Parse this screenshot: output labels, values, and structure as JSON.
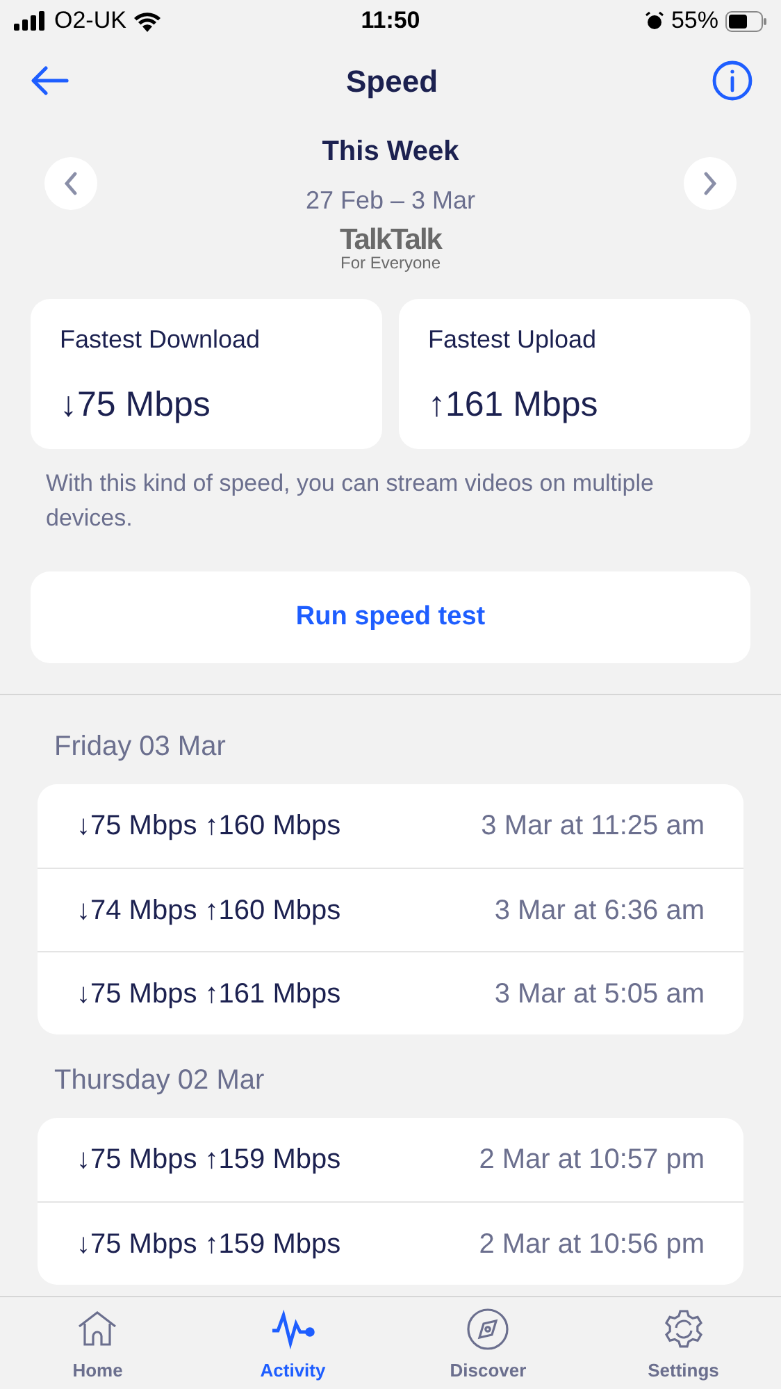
{
  "status_bar": {
    "carrier": "O2-UK",
    "time": "11:50",
    "battery": "55%"
  },
  "nav": {
    "title": "Speed"
  },
  "period": {
    "title": "This Week",
    "range": "27 Feb – 3 Mar",
    "brand": "TalkTalk",
    "tagline": "For Everyone"
  },
  "stats": [
    {
      "label": "Fastest Download",
      "value": "↓75 Mbps"
    },
    {
      "label": "Fastest Upload",
      "value": "↑161 Mbps"
    }
  ],
  "note": "With this kind of speed, you can stream videos on multiple devices.",
  "run_button": "Run speed test",
  "days": [
    {
      "title": "Friday 03 Mar",
      "tests": [
        {
          "speed": "↓75 Mbps ↑160 Mbps",
          "time": "3 Mar at 11:25 am"
        },
        {
          "speed": "↓74 Mbps ↑160 Mbps",
          "time": "3 Mar at 6:36 am"
        },
        {
          "speed": "↓75 Mbps ↑161 Mbps",
          "time": "3 Mar at 5:05 am"
        }
      ]
    },
    {
      "title": "Thursday 02 Mar",
      "tests": [
        {
          "speed": "↓75 Mbps ↑159 Mbps",
          "time": "2 Mar at 10:57 pm"
        },
        {
          "speed": "↓75 Mbps ↑159 Mbps",
          "time": "2 Mar at 10:56 pm"
        }
      ]
    }
  ],
  "tabs": [
    {
      "label": "Home",
      "kind": "home",
      "selected": false
    },
    {
      "label": "Activity",
      "kind": "activity",
      "selected": true
    },
    {
      "label": "Discover",
      "kind": "compass",
      "selected": false
    },
    {
      "label": "Settings",
      "kind": "gear",
      "selected": false
    }
  ]
}
